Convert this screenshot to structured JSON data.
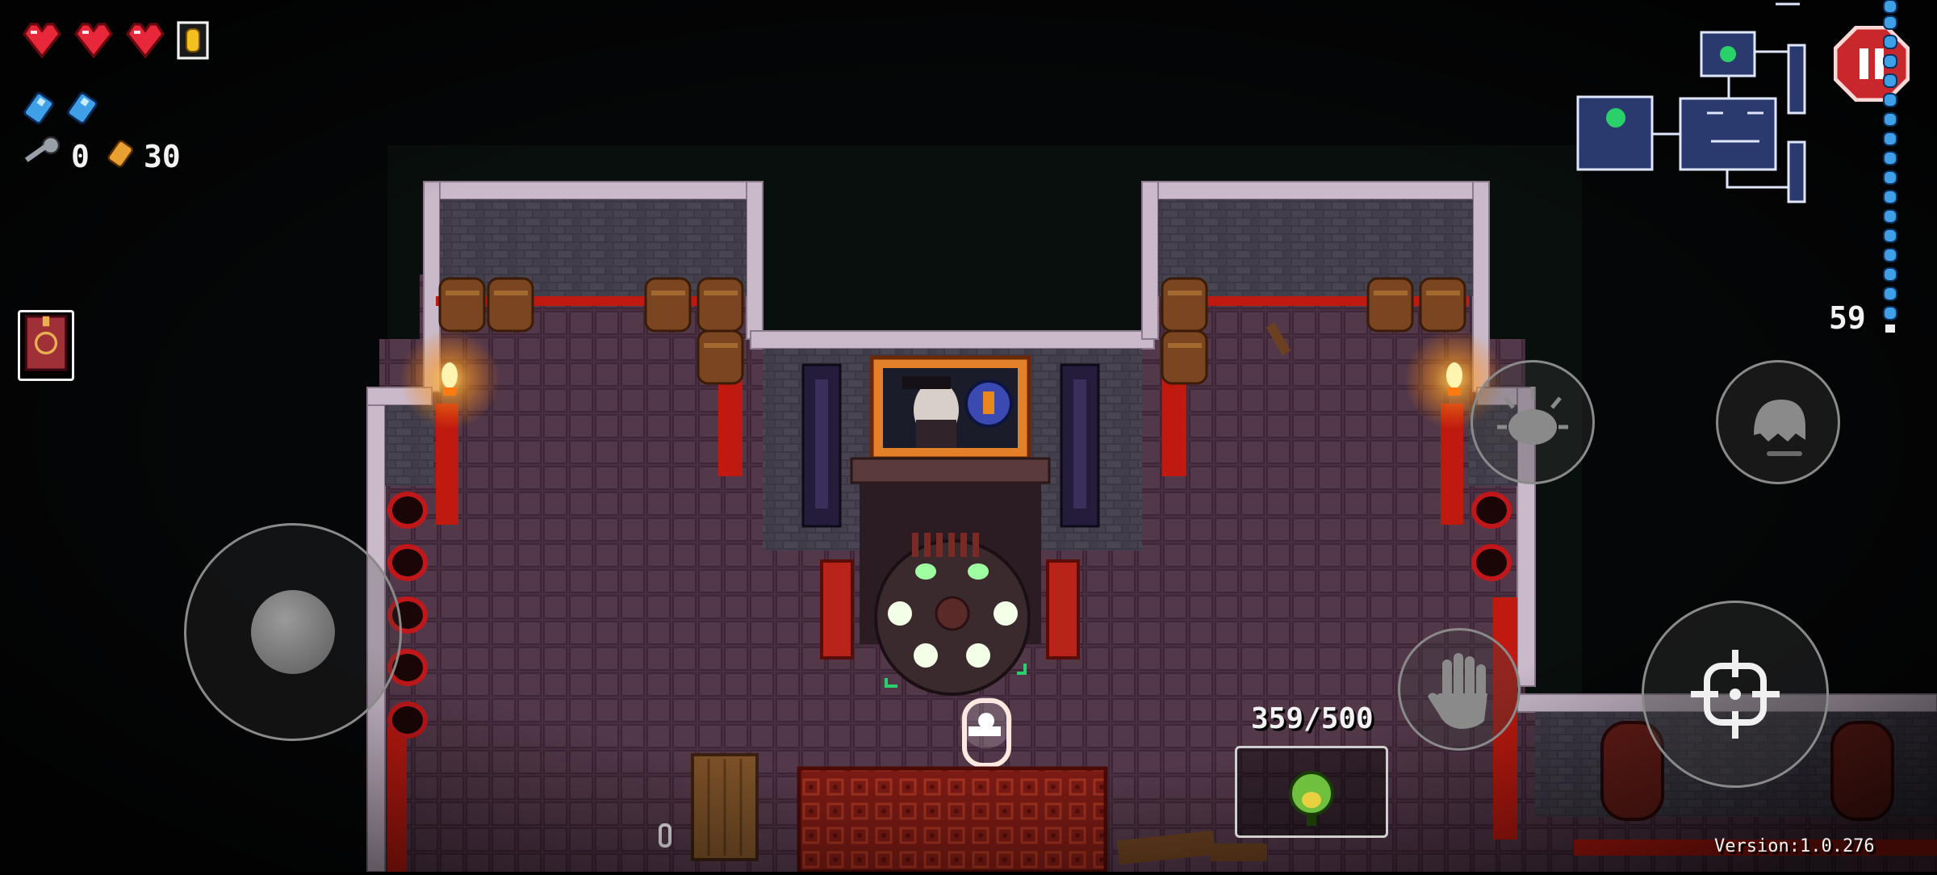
{
  "hud": {
    "hearts": [
      "full",
      "full",
      "full"
    ],
    "armor_count": 1,
    "blanks_count": 2,
    "keys_count": "0",
    "shells_count": "30",
    "ammo_right": "59",
    "ammo_ratio": "359/500",
    "version": "Version:1.0.276"
  },
  "colors": {
    "heart": "#e8283a",
    "floor": "#4a3040",
    "wall": "#3a3540",
    "wall_top": "#c9b8c8",
    "lava_trim": "#c81a10",
    "torch": "#ffb030",
    "pause_red": "#c8282c",
    "minimap_room": "#2a3a6e",
    "ammo_pip": "#3fa0e8"
  },
  "icons": {
    "pause": "pause-icon",
    "dodge_roll": "ghost-icon",
    "interact": "hand-icon",
    "aim": "crosshair-icon",
    "blank": "blank-icon",
    "key": "key-icon",
    "shell": "shell-currency-icon",
    "active_item": "book-icon",
    "gun": "frog-gun-icon"
  }
}
